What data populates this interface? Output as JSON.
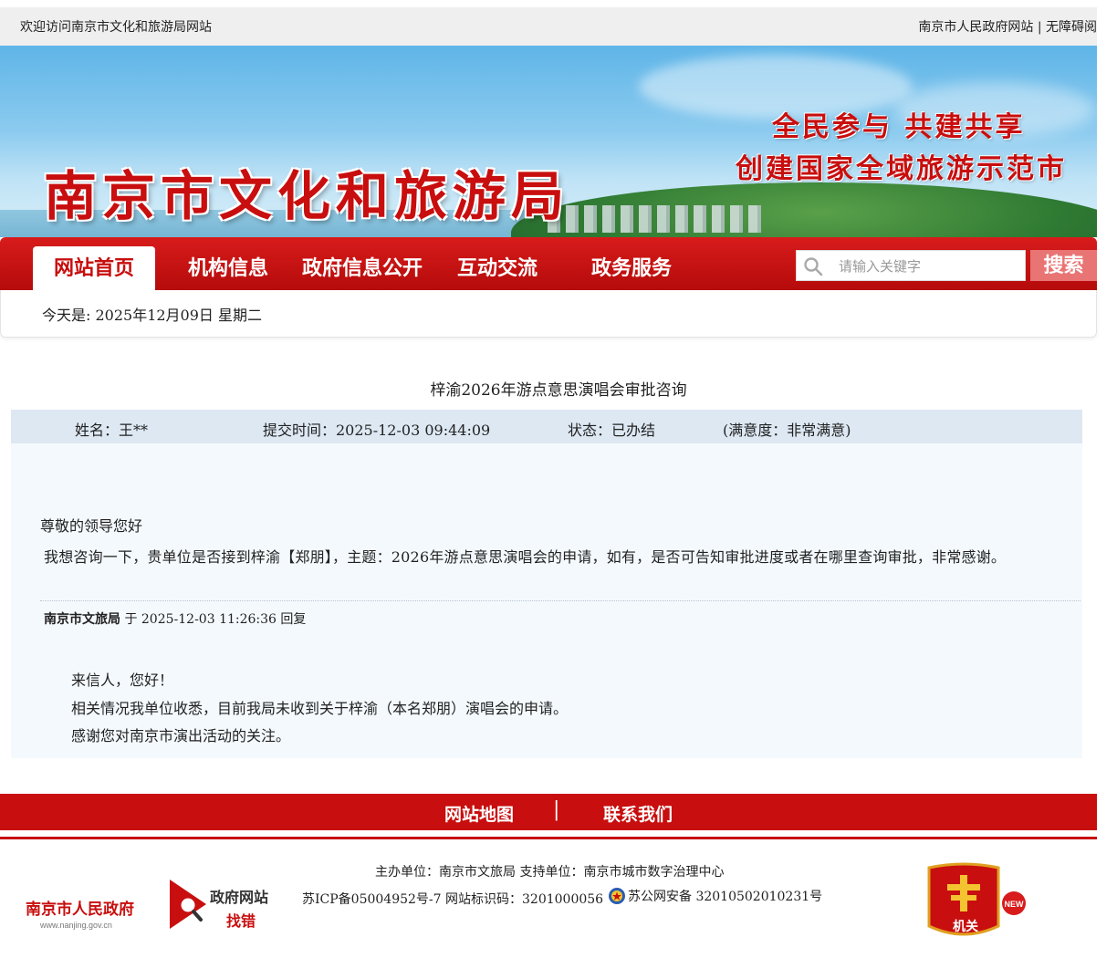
{
  "topbar": {
    "welcome": "欢迎访问南京市文化和旅游局网站",
    "links": "南京市人民政府网站 | 无障碍阅"
  },
  "banner": {
    "site_title": "南京市文化和旅游局",
    "slogan1": "全民参与 共建共享",
    "slogan2": "创建国家全域旅游示范市"
  },
  "nav": {
    "tabs": [
      {
        "label": "网站首页"
      },
      {
        "label": "机构信息"
      },
      {
        "label": "政府信息公开"
      },
      {
        "label": "互动交流"
      },
      {
        "label": "政务服务"
      }
    ],
    "search_placeholder": "请输入关键字",
    "search_button": "搜索"
  },
  "datebar": {
    "text": "今天是: 2025年12月09日 星期二"
  },
  "letter": {
    "title": "梓渝2026年游点意思演唱会审批咨询",
    "name": "姓名：王**",
    "submit_time": "提交时间：2025-12-03 09:44:09",
    "status": "状态：已办结",
    "satisfaction": "(满意度：非常满意)",
    "greeting": "尊敬的领导您好",
    "body": "我想咨询一下，贵单位是否接到梓渝【郑朋】，主题：2026年游点意思演唱会的申请，如有，是否可告知审批进度或者在哪里查询审批，非常感谢。",
    "reply_org": "南京市文旅局",
    "reply_meta": " 于 2025-12-03 11:26:36 回复",
    "reply_lines": [
      "来信人，您好！",
      "相关情况我单位收悉，目前我局未收到关于梓渝（本名郑朋）演唱会的申请。",
      "感谢您对南京市演出活动的关注。"
    ]
  },
  "footer": {
    "nav": [
      "网站地图",
      "联系我们"
    ],
    "separator": "|",
    "host": "主办单位：南京市文旅局  支持单位：南京市城市数字治理中心",
    "icp": "苏ICP备05004952号-7  网站标识码：3201000056",
    "police": "苏公网安备 32010502010231号",
    "logo_nj_title": "南京市人民政府",
    "logo_nj_url": "www.nanjing.gov.cn",
    "logo_zc_line1": "政府网站",
    "logo_zc_line2": "找错",
    "logo_jg": "机关",
    "logo_new": "NEW"
  },
  "colors": {
    "brand_red": "#c80e0e",
    "meta_bg": "#dde8f3",
    "content_bg": "#f4f9fd"
  }
}
